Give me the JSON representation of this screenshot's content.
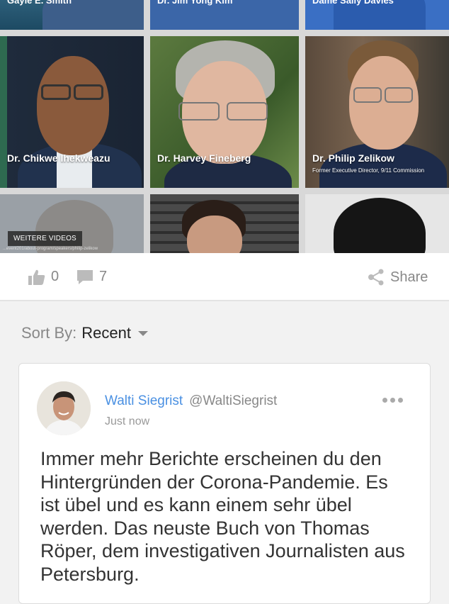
{
  "video_grid": {
    "top_row": [
      "Gayle E. Smith",
      "Dr. Jim Yong Kim",
      "Dame Sally Davies"
    ],
    "middle_row": [
      {
        "name": "Dr. Chikwe Ihekweazu",
        "subtitle": ""
      },
      {
        "name": "Dr. Harvey Fineberg",
        "subtitle": ""
      },
      {
        "name": "Dr. Philip Zelikow",
        "subtitle": "Former Executive Director, 9/11 Commission"
      }
    ],
    "more_videos_label": "WEITERE VIDEOS",
    "url_hint": "...event201/about-program/speakers/philip-zelikow"
  },
  "actions": {
    "likes": "0",
    "comments": "7",
    "share_label": "Share"
  },
  "sort": {
    "label": "Sort By:",
    "value": "Recent"
  },
  "comment": {
    "author_name": "Walti Siegrist",
    "author_handle": "@WaltiSiegrist",
    "time": "Just now",
    "text": "Immer mehr Berichte erscheinen du den Hintergründen der Corona-Pandemie. Es ist übel und es kann einem sehr übel werden. Das neuste Buch von Thomas Röper, dem investigativen Journalisten aus Petersburg."
  },
  "colors": {
    "accent": "#4a90e2",
    "icon_grey": "#bbbbbb"
  }
}
